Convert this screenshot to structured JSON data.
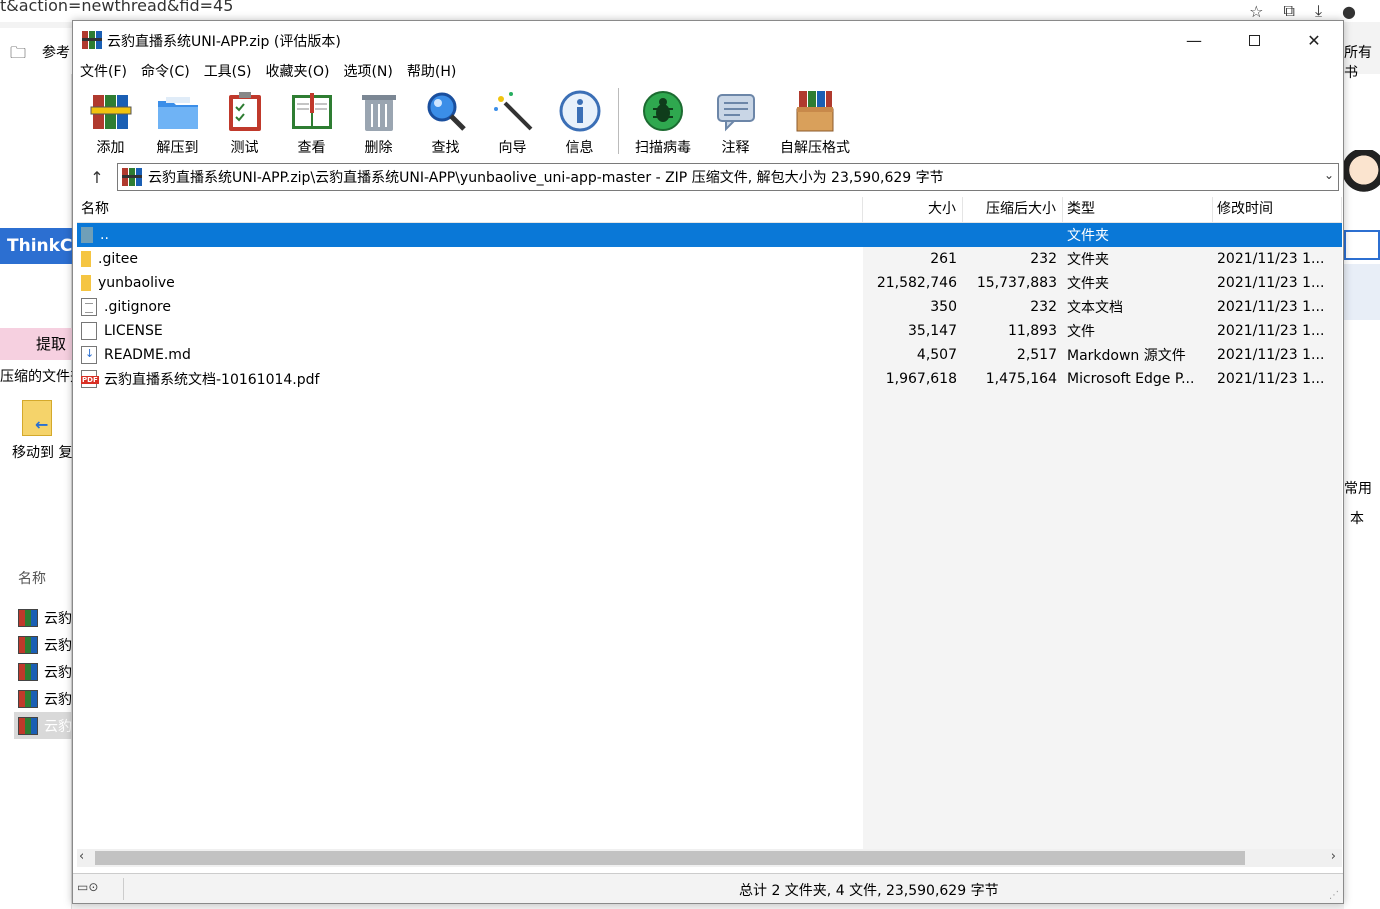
{
  "background": {
    "url_fragment": "t&action=newthread&fid=45",
    "bookmark_label": "参考",
    "thinkc_label": "ThinkCl",
    "extract_label": "提取",
    "zipped_files_label": "压缩的文件夹",
    "move_to_label": "移动到 复",
    "name_header": "名称",
    "file_labels": [
      "云豹",
      "云豹",
      "云豹",
      "云豹",
      "云豹"
    ],
    "right_all_label": "所有书",
    "right_common_label": "常用",
    "right_text_label": "本"
  },
  "window": {
    "title": "云豹直播系统UNI-APP.zip (评估版本)",
    "controls": {
      "minimize": "—",
      "close": "✕"
    }
  },
  "menu": [
    "文件(F)",
    "命令(C)",
    "工具(S)",
    "收藏夹(O)",
    "选项(N)",
    "帮助(H)"
  ],
  "toolbar": [
    {
      "label": "添加",
      "icon": "add-archive-icon"
    },
    {
      "label": "解压到",
      "icon": "extract-to-icon"
    },
    {
      "label": "测试",
      "icon": "test-icon"
    },
    {
      "label": "查看",
      "icon": "view-icon"
    },
    {
      "label": "删除",
      "icon": "delete-icon"
    },
    {
      "label": "查找",
      "icon": "find-icon"
    },
    {
      "label": "向导",
      "icon": "wizard-icon"
    },
    {
      "label": "信息",
      "icon": "info-icon"
    },
    {
      "label": "扫描病毒",
      "icon": "virus-scan-icon"
    },
    {
      "label": "注释",
      "icon": "comment-icon"
    },
    {
      "label": "自解压格式",
      "icon": "sfx-icon"
    }
  ],
  "address": {
    "path": "云豹直播系统UNI-APP.zip\\云豹直播系统UNI-APP\\yunbaolive_uni-app-master - ZIP 压缩文件, 解包大小为 23,590,629 字节"
  },
  "columns": {
    "name": "名称",
    "size": "大小",
    "packed": "压缩后大小",
    "type": "类型",
    "modified": "修改时间"
  },
  "files": [
    {
      "name": "..",
      "size": "",
      "packed": "",
      "type": "文件夹",
      "modified": "",
      "icon": "updir",
      "selected": true
    },
    {
      "name": ".gitee",
      "size": "261",
      "packed": "232",
      "type": "文件夹",
      "modified": "2021/11/23 1...",
      "icon": "folder"
    },
    {
      "name": "yunbaolive",
      "size": "21,582,746",
      "packed": "15,737,883",
      "type": "文件夹",
      "modified": "2021/11/23 1...",
      "icon": "folder"
    },
    {
      "name": ".gitignore",
      "size": "350",
      "packed": "232",
      "type": "文本文档",
      "modified": "2021/11/23 1...",
      "icon": "txt"
    },
    {
      "name": "LICENSE",
      "size": "35,147",
      "packed": "11,893",
      "type": "文件",
      "modified": "2021/11/23 1...",
      "icon": "blank"
    },
    {
      "name": "README.md",
      "size": "4,507",
      "packed": "2,517",
      "type": "Markdown 源文件",
      "modified": "2021/11/23 1...",
      "icon": "md"
    },
    {
      "name": "云豹直播系统文档-10161014.pdf",
      "size": "1,967,618",
      "packed": "1,475,164",
      "type": "Microsoft Edge P...",
      "modified": "2021/11/23 1...",
      "icon": "pdf"
    }
  ],
  "status": {
    "summary": "总计 2 文件夹, 4 文件, 23,590,629 字节"
  }
}
